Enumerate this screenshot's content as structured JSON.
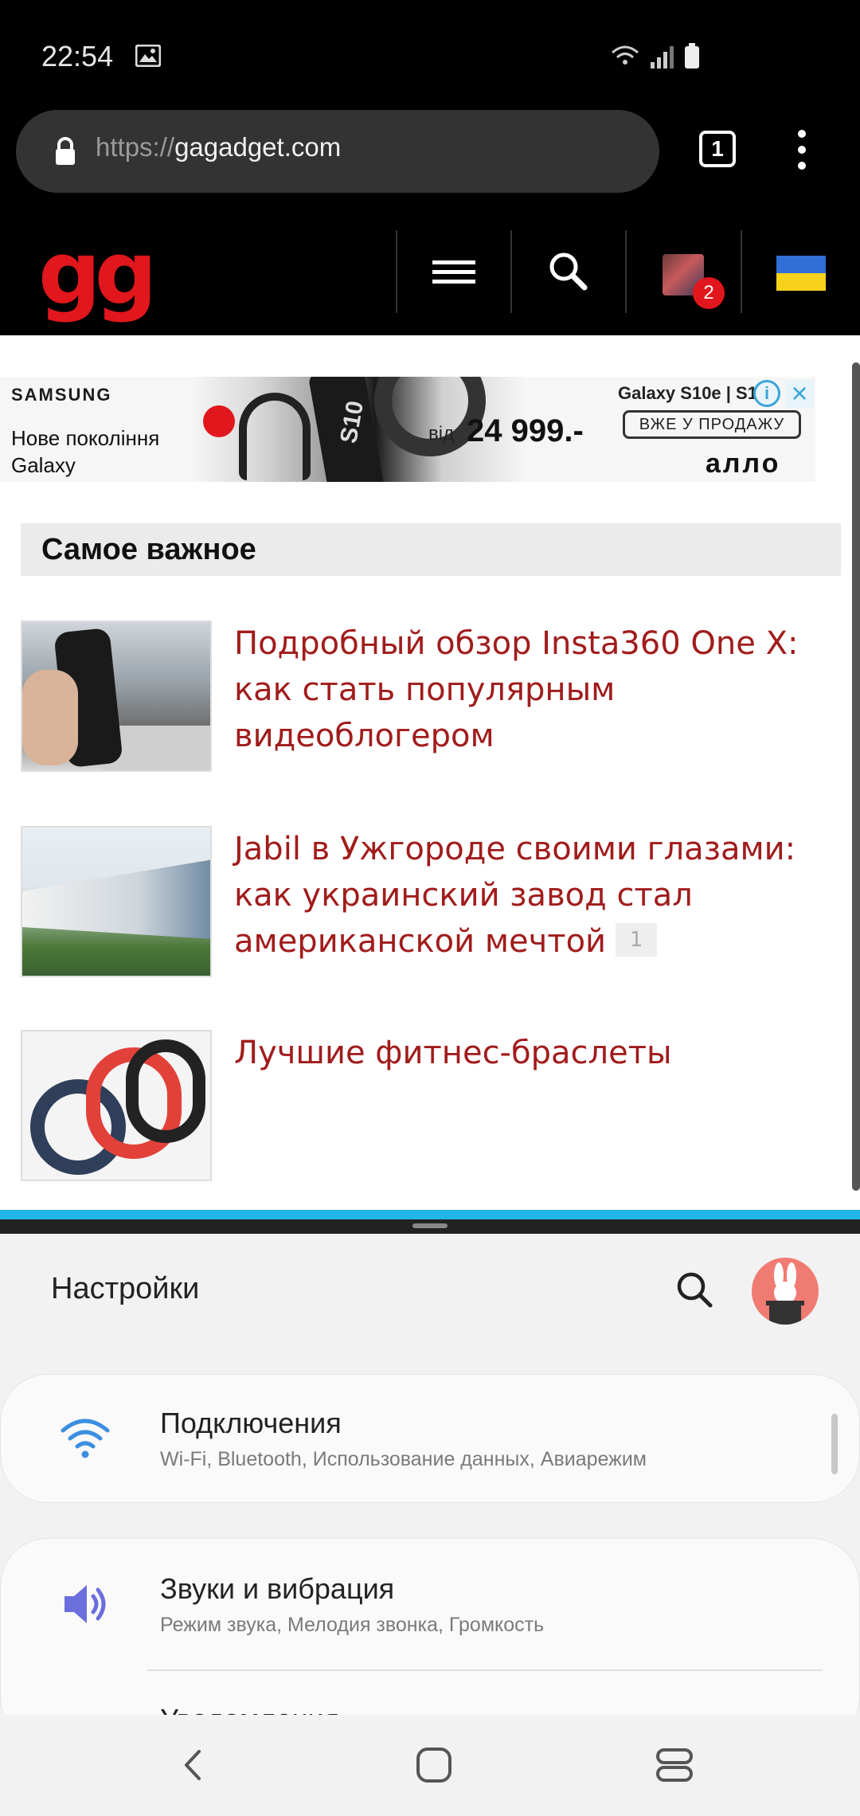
{
  "status_bar": {
    "time": "22:54"
  },
  "browser": {
    "url_scheme": "https://",
    "url_host": "gagadget.com",
    "tab_count": "1"
  },
  "site_header": {
    "logo": "gg",
    "notification_count": "2"
  },
  "ad": {
    "brand": "SAMSUNG",
    "tagline_line1": "Нове покоління",
    "tagline_line2": "Galaxy",
    "price_prefix": "від",
    "price": "24 999.-",
    "model": "Galaxy S10e | S1",
    "cta": "ВЖЕ У ПРОДАЖУ",
    "store": "алло",
    "phone_label": "S10"
  },
  "section_title": "Самое важное",
  "articles": [
    {
      "title": "Подробный обзор Insta360 One X: как стать популярным видеоблогером",
      "comments": ""
    },
    {
      "title": "Jabil в Ужгороде своими глазами: как украинский завод стал американской мечтой",
      "comments": "1"
    },
    {
      "title": "Лучшие фитнес-браслеты",
      "comments": ""
    }
  ],
  "settings": {
    "title": "Настройки",
    "items": [
      {
        "name": "Подключения",
        "sub": "Wi-Fi, Bluetooth, Использование данных, Авиарежим",
        "icon": "wifi-icon"
      },
      {
        "name": "Звуки и вибрация",
        "sub": "Режим звука, Мелодия звонка, Громкость",
        "icon": "speaker-icon"
      },
      {
        "name": "Уведомления",
        "sub": "",
        "icon": "notification-icon"
      }
    ]
  },
  "colors": {
    "logo_red": "#e2161d",
    "article_title": "#a11c1c",
    "divider_blue": "#20b6e8",
    "wifi_blue": "#3c8fe0",
    "speaker_purple": "#6b6fdc"
  }
}
